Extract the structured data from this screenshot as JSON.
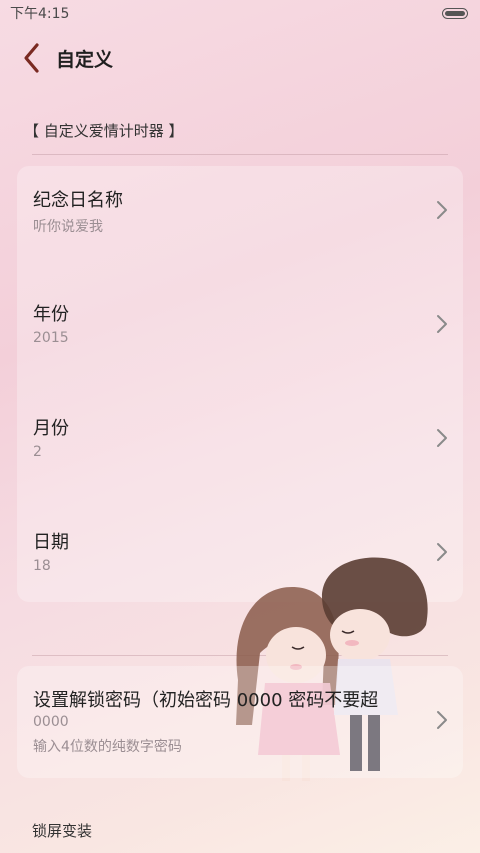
{
  "status_bar": {
    "time": "下午4:15"
  },
  "header": {
    "title": "自定义"
  },
  "section": {
    "title": "【 自定义爱情计时器 】"
  },
  "items": [
    {
      "label": "纪念日名称",
      "value": "听你说爱我"
    },
    {
      "label": "年份",
      "value": "2015"
    },
    {
      "label": "月份",
      "value": "2"
    },
    {
      "label": "日期",
      "value": "18"
    }
  ],
  "password": {
    "label": "设置解锁密码（初始密码 0000 密码不要超",
    "value": "0000",
    "hint": "输入4位数的纯数字密码"
  },
  "next_section": {
    "title": "锁屏变装"
  },
  "colors": {
    "accent": "#7a2a22",
    "background": "#f3cfd9"
  }
}
